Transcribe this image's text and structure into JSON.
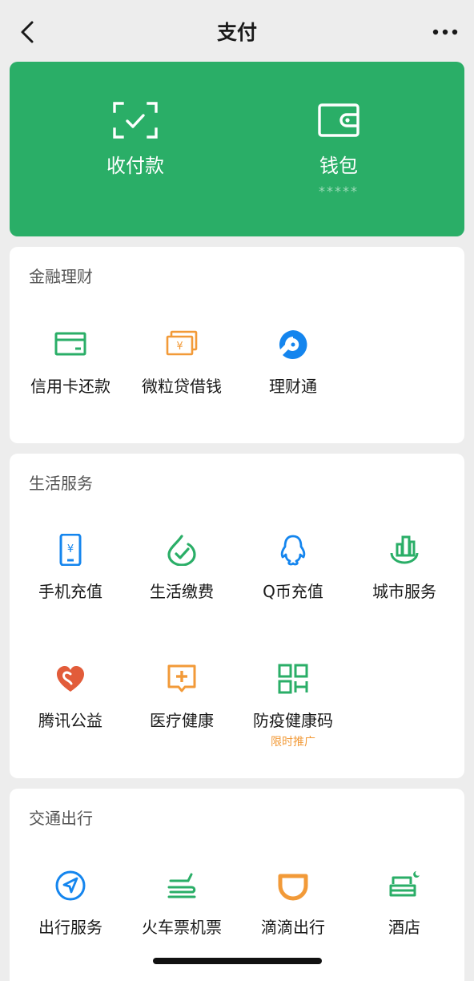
{
  "nav": {
    "title": "支付",
    "back_icon": "chevron-left-icon",
    "more_icon": "more-dots-icon"
  },
  "hero": {
    "background": "#2aae67",
    "items": [
      {
        "label": "收付款",
        "icon": "scan-check-icon"
      },
      {
        "label": "钱包",
        "sub": "*****",
        "icon": "wallet-icon"
      }
    ]
  },
  "finance": {
    "title": "金融理财",
    "items": [
      {
        "label": "信用卡还款",
        "icon": "credit-card-icon"
      },
      {
        "label": "微粒贷借钱",
        "icon": "loan-money-icon"
      },
      {
        "label": "理财通",
        "icon": "wealth-icon"
      }
    ]
  },
  "life": {
    "title": "生活服务",
    "items": [
      {
        "label": "手机充值",
        "icon": "phone-topup-icon"
      },
      {
        "label": "生活缴费",
        "icon": "utility-bill-icon"
      },
      {
        "label": "Q币充值",
        "icon": "qq-penguin-icon"
      },
      {
        "label": "城市服务",
        "icon": "city-service-icon"
      },
      {
        "label": "腾讯公益",
        "icon": "charity-heart-icon"
      },
      {
        "label": "医疗健康",
        "icon": "medical-icon"
      },
      {
        "label": "防疫健康码",
        "sub": "限时推广",
        "icon": "qr-code-icon"
      }
    ]
  },
  "transport": {
    "title": "交通出行",
    "items": [
      {
        "label": "出行服务",
        "icon": "navigation-icon"
      },
      {
        "label": "火车票机票",
        "icon": "train-plane-icon"
      },
      {
        "label": "滴滴出行",
        "icon": "didi-icon"
      },
      {
        "label": "酒店",
        "icon": "hotel-bed-icon"
      }
    ]
  },
  "colors": {
    "green": "#2aae67",
    "blue": "#1485ee",
    "orange": "#f29a38",
    "red": "#e25c3a"
  }
}
